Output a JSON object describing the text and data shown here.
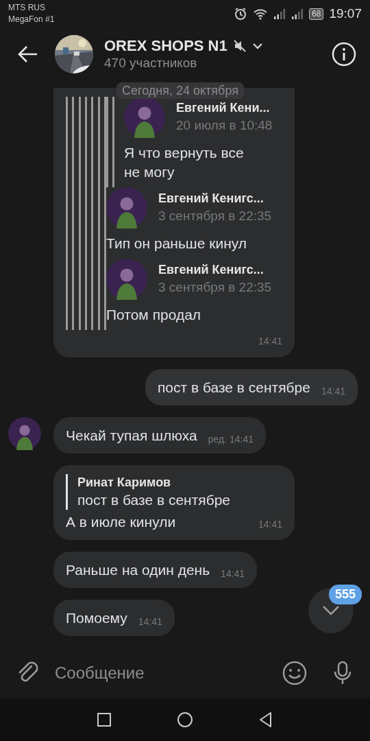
{
  "status_bar": {
    "carriers": [
      "MTS RUS",
      "MegaFon #1"
    ],
    "battery": "68",
    "time": "19:07"
  },
  "header": {
    "title": "OREX SHOPS N1",
    "muted": true,
    "subtitle": "470 участников"
  },
  "date_pill": "Сегодня, 24 октября",
  "messages": [
    {
      "kind": "forwarded",
      "outgoing": false,
      "show_avatar": false,
      "forwarded": [
        {
          "children": [
            {
              "author": "Евгений Кени...",
              "date": "20 июля в 10:48",
              "text": "Я что вернуть все не могу"
            }
          ]
        },
        {
          "author": "Евгений Кенигс...",
          "date": "3 сентября в 22:35",
          "text": "Тип он раньше кинул"
        },
        {
          "author": "Евгений Кенигс...",
          "date": "3 сентября в 22:35",
          "text": "Потом продал"
        }
      ],
      "time": "14:41"
    },
    {
      "kind": "text",
      "outgoing": true,
      "show_avatar": false,
      "text": "пост в базе в сентябре",
      "time": "14:41"
    },
    {
      "kind": "text",
      "outgoing": false,
      "show_avatar": true,
      "text": "Чекай тупая шлюха",
      "edited_label": "ред.",
      "time": "14:41"
    },
    {
      "kind": "reply",
      "outgoing": false,
      "show_avatar": false,
      "reply": {
        "author": "Ринат Каримов",
        "text": "пост в базе в сентябре"
      },
      "text": "А в июле кинули",
      "time": "14:41"
    },
    {
      "kind": "text",
      "outgoing": false,
      "show_avatar": false,
      "text": "Раньше на один день",
      "time": "14:41"
    },
    {
      "kind": "text",
      "outgoing": false,
      "show_avatar": false,
      "text": "Помоему",
      "time": "14:41"
    }
  ],
  "scroll_button": {
    "badge": "555"
  },
  "composer": {
    "placeholder": "Сообщение"
  }
}
